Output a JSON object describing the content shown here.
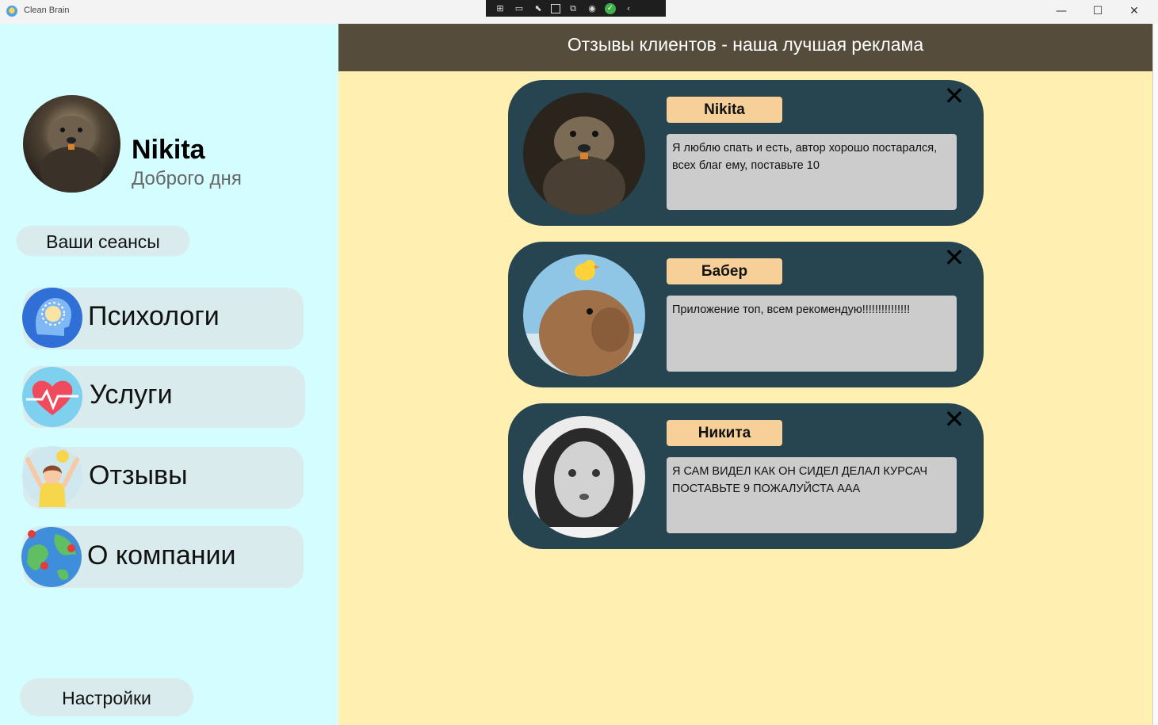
{
  "window": {
    "title": "Clean Brain"
  },
  "debug_toolbar": {
    "icons": [
      "live-tree-icon",
      "video-icon",
      "select-element-icon",
      "display-layout-icon",
      "track-focus-icon",
      "hot-reload-icon",
      "check-icon",
      "collapse-icon"
    ]
  },
  "sidebar": {
    "user_name": "Nikita",
    "greeting": "Доброго дня",
    "sessions_label": "Ваши сеансы",
    "nav": [
      {
        "label": "Психологи",
        "icon": "brain-head-icon"
      },
      {
        "label": "Услуги",
        "icon": "heartbeat-icon"
      },
      {
        "label": "Отзывы",
        "icon": "happy-person-icon"
      },
      {
        "label": "О компании",
        "icon": "globe-pins-icon"
      }
    ],
    "settings_label": "Настройки"
  },
  "main": {
    "header_title": "Отзывы клиентов - наша лучшая реклама",
    "reviews": [
      {
        "author": "Nikita",
        "text": "Я люблю спать и есть, автор хорошо постарался, всех благ ему, поставьте 10",
        "avatar": "beaver-avatar"
      },
      {
        "author": "Бабер",
        "text": "Приложение топ, всем рекомендую!!!!!!!!!!!!!!!",
        "avatar": "capybara-duck-avatar"
      },
      {
        "author": "Никита",
        "text": "Я САМ ВИДЕЛ КАК ОН СИДЕЛ ДЕЛАЛ КУРСАЧ ПОСТАВЬТЕ 9 ПОЖАЛУЙСТА ААА",
        "avatar": "person-bw-avatar"
      }
    ]
  },
  "colors": {
    "sidebar_bg": "#d3fdfe",
    "nav_item_bg": "#d9ebec",
    "main_bg": "#ffefb0",
    "header_bg": "#564c3b",
    "card_bg": "#264551",
    "badge_bg": "#f7cf98",
    "text_box_bg": "#cccccc"
  }
}
